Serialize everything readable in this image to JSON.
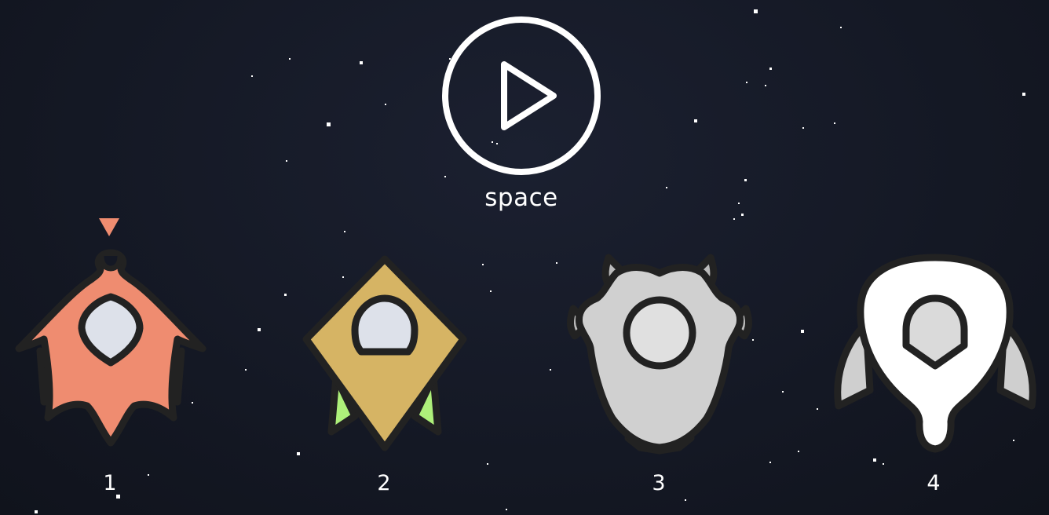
{
  "play": {
    "label": "space"
  },
  "ships": [
    {
      "number": "1",
      "body_color": "#ef8c70",
      "wing_color": "#d6b464",
      "window_color": "#dde1ea",
      "selected": true
    },
    {
      "number": "2",
      "body_color": "#d6b464",
      "wing_color": "#aef07a",
      "window_color": "#dde1ea",
      "selected": false
    },
    {
      "number": "3",
      "body_color": "#d0d0d0",
      "wing_color": "#bbbbbb",
      "window_color": "#e0e0e0",
      "selected": false
    },
    {
      "number": "4",
      "body_color": "#ffffff",
      "wing_color": "#cfcfcf",
      "window_color": "#dadada",
      "selected": false
    }
  ],
  "colors": {
    "outline": "#222222",
    "selector": "#ef8c70",
    "star": "#ffffff"
  }
}
